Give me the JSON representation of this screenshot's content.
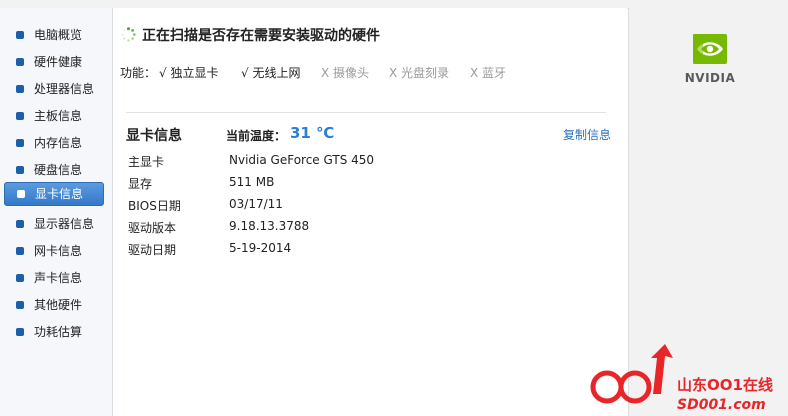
{
  "sidebar": {
    "items": [
      {
        "label": "电脑概览"
      },
      {
        "label": "硬件健康"
      },
      {
        "label": "处理器信息"
      },
      {
        "label": "主板信息"
      },
      {
        "label": "内存信息"
      },
      {
        "label": "硬盘信息"
      },
      {
        "label": "显卡信息",
        "active": true
      },
      {
        "label": "显示器信息"
      },
      {
        "label": "网卡信息"
      },
      {
        "label": "声卡信息"
      },
      {
        "label": "其他硬件"
      },
      {
        "label": "功耗估算"
      }
    ]
  },
  "scan": {
    "title": "正在扫描是否存在需要安装驱动的硬件"
  },
  "functions": {
    "label": "功能：",
    "items": [
      {
        "label": "√ 独立显卡",
        "enabled": true
      },
      {
        "label": "√ 无线上网",
        "enabled": true
      },
      {
        "label": "X 摄像头",
        "enabled": false
      },
      {
        "label": "X 光盘刻录",
        "enabled": false
      },
      {
        "label": "X 蓝牙",
        "enabled": false
      }
    ]
  },
  "gpu": {
    "section_title": "显卡信息",
    "temp_label": "当前温度：",
    "temp_value": "31 ℃",
    "copy_label": "复制信息",
    "rows": [
      {
        "label": "主显卡",
        "value": "Nvidia GeForce GTS 450"
      },
      {
        "label": "显存",
        "value": "511 MB"
      },
      {
        "label": "BIOS日期",
        "value": "03/17/11"
      },
      {
        "label": "驱动版本",
        "value": "9.18.13.3788"
      },
      {
        "label": "驱动日期",
        "value": "5-19-2014"
      }
    ]
  },
  "brand": {
    "logo_text": "NVIDIA",
    "logo_green": "#76b900"
  },
  "watermark": {
    "cn_text": "山东OO1在线",
    "url_text": "SD001.com",
    "color": "#e8262a"
  }
}
